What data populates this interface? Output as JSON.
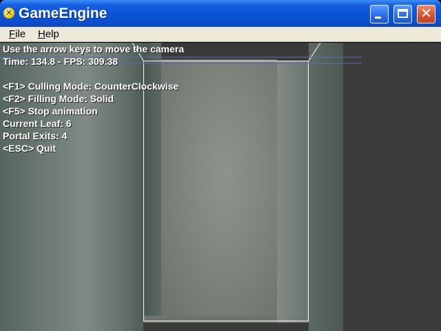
{
  "window": {
    "title": "GameEngine",
    "minimize_label": "",
    "maximize_label": "",
    "close_label": "✕"
  },
  "menu": {
    "file_hotkey": "F",
    "file_rest": "ile",
    "help_hotkey": "H",
    "help_rest": "elp"
  },
  "overlay": {
    "line1": "Use the arrow keys to move the camera",
    "line2": "Time:  134.8 - FPS:  309.38",
    "line3": "<F1> Culling Mode: CounterClockwise",
    "line4": "<F2> Filling Mode: Solid",
    "line5": "<F5> Stop animation",
    "line6": "Current Leaf: 6",
    "line7": "Portal Exits: 4",
    "line8": "<ESC> Quit"
  },
  "colors": {
    "titlebar": "#0a4fd0",
    "menubar": "#ece9d8",
    "close_button": "#d9542f",
    "overlay_text": "#ffffff",
    "portal_outline": "#ffffff"
  }
}
